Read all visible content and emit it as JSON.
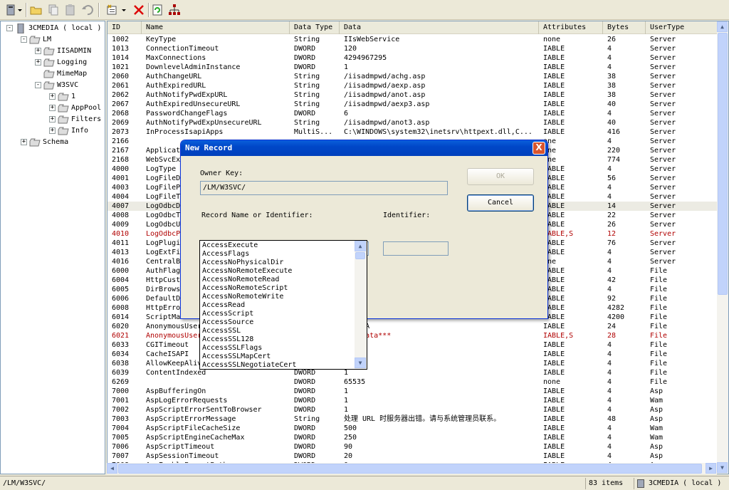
{
  "toolbar": {
    "icons": [
      "server-icon",
      "dropdown-arrow-icon",
      "open-folder-icon",
      "copy-icon",
      "paste-icon",
      "undo-icon",
      "new-record-icon",
      "dropdown-arrow-icon",
      "delete-icon",
      "refresh-icon",
      "network-icon"
    ]
  },
  "tree": {
    "nodes": [
      {
        "label": "3CMEDIA ( local )",
        "level": 0,
        "expander": "-"
      },
      {
        "label": "LM",
        "level": 1,
        "expander": "-"
      },
      {
        "label": "IISADMIN",
        "level": 2,
        "expander": "+"
      },
      {
        "label": "Logging",
        "level": 2,
        "expander": "+"
      },
      {
        "label": "MimeMap",
        "level": 2,
        "expander": ""
      },
      {
        "label": "W3SVC",
        "level": 2,
        "expander": "-"
      },
      {
        "label": "1",
        "level": 3,
        "expander": "+"
      },
      {
        "label": "AppPool",
        "level": 3,
        "expander": "+"
      },
      {
        "label": "Filters",
        "level": 3,
        "expander": "+"
      },
      {
        "label": "Info",
        "level": 3,
        "expander": "+"
      },
      {
        "label": "Schema",
        "level": 1,
        "expander": "+"
      }
    ]
  },
  "columns": [
    "ID",
    "Name",
    "Data Type",
    "Data",
    "Attributes",
    "Bytes",
    "UserType"
  ],
  "rows": [
    [
      "1002",
      "KeyType",
      "String",
      "IIsWebService",
      "none",
      "26",
      "Server"
    ],
    [
      "1013",
      "ConnectionTimeout",
      "DWORD",
      "120",
      "IABLE",
      "4",
      "Server"
    ],
    [
      "1014",
      "MaxConnections",
      "DWORD",
      "4294967295",
      "IABLE",
      "4",
      "Server"
    ],
    [
      "1021",
      "DownlevelAdminInstance",
      "DWORD",
      "1",
      "IABLE",
      "4",
      "Server"
    ],
    [
      "2060",
      "AuthChangeURL",
      "String",
      "/iisadmpwd/achg.asp",
      "IABLE",
      "38",
      "Server"
    ],
    [
      "2061",
      "AuthExpiredURL",
      "String",
      "/iisadmpwd/aexp.asp",
      "IABLE",
      "38",
      "Server"
    ],
    [
      "2062",
      "AuthNotifyPwdExpURL",
      "String",
      "/iisadmpwd/anot.asp",
      "IABLE",
      "38",
      "Server"
    ],
    [
      "2067",
      "AuthExpiredUnsecureURL",
      "String",
      "/iisadmpwd/aexp3.asp",
      "IABLE",
      "40",
      "Server"
    ],
    [
      "2068",
      "PasswordChangeFlags",
      "DWORD",
      "6",
      "IABLE",
      "4",
      "Server"
    ],
    [
      "2069",
      "AuthNotifyPwdExpUnsecureURL",
      "String",
      "/iisadmpwd/anot3.asp",
      "IABLE",
      "40",
      "Server"
    ],
    [
      "2073",
      "InProcessIsapiApps",
      "MultiS...",
      "C:\\WINDOWS\\system32\\inetsrv\\httpext.dll,C...",
      "IABLE",
      "416",
      "Server"
    ],
    [
      "2166",
      "",
      "",
      "",
      "one",
      "4",
      "Server"
    ],
    [
      "2167",
      "Applicat",
      "",
      "",
      "one",
      "220",
      "Server"
    ],
    [
      "2168",
      "WebSvcEx",
      "",
      "",
      "one",
      "774",
      "Server"
    ],
    [
      "4000",
      "LogType",
      "",
      "",
      "IABLE",
      "4",
      "Server"
    ],
    [
      "4001",
      "LogFileD",
      "",
      "",
      "IABLE",
      "56",
      "Server"
    ],
    [
      "4003",
      "LogFileP",
      "",
      "",
      "IABLE",
      "4",
      "Server"
    ],
    [
      "4004",
      "LogFileT",
      "",
      "",
      "IABLE",
      "4",
      "Server"
    ],
    [
      "4007",
      "LogOdbcD",
      "",
      "",
      "IABLE",
      "14",
      "Server"
    ],
    [
      "4008",
      "LogOdbcT",
      "",
      "",
      "IABLE",
      "22",
      "Server"
    ],
    [
      "4009",
      "LogOdbcU",
      "",
      "",
      "IABLE",
      "26",
      "Server"
    ],
    [
      "4010",
      "LogOdbcP",
      "",
      "",
      "IABLE,S",
      "12",
      "Server"
    ],
    [
      "4011",
      "LogPlugi",
      "",
      "",
      "IABLE",
      "76",
      "Server"
    ],
    [
      "4013",
      "LogExtFi",
      "",
      "",
      "IABLE",
      "4",
      "Server"
    ],
    [
      "4016",
      "CentralB",
      "",
      "",
      "one",
      "4",
      "Server"
    ],
    [
      "6000",
      "AuthFlag",
      "",
      "",
      "IABLE",
      "4",
      "File"
    ],
    [
      "6004",
      "HttpCust",
      "",
      "",
      "IABLE",
      "42",
      "File"
    ],
    [
      "6005",
      "DirBrows",
      "",
      "",
      "IABLE",
      "4",
      "File"
    ],
    [
      "6006",
      "DefaultD",
      "",
      "",
      "IABLE",
      "92",
      "File"
    ],
    [
      "6008",
      "HttpErro",
      "",
      "",
      "IABLE",
      "4282",
      "File"
    ],
    [
      "6014",
      "ScriptMa",
      "",
      "",
      "IABLE",
      "4200",
      "File"
    ],
    [
      "6020",
      "AnonymousUser",
      "",
      "CMEDIA",
      "IABLE",
      "24",
      "File"
    ],
    [
      "6021",
      "AnonymousUser",
      "",
      "ure Data***",
      "IABLE,S",
      "28",
      "File"
    ],
    [
      "6033",
      "CGITimeout",
      "",
      "",
      "IABLE",
      "4",
      "File"
    ],
    [
      "6034",
      "CacheISAPI",
      "",
      "",
      "IABLE",
      "4",
      "File"
    ],
    [
      "6038",
      "AllowKeepAliv",
      "",
      "",
      "IABLE",
      "4",
      "File"
    ],
    [
      "6039",
      "ContentIndexed",
      "DWORD",
      "1",
      "IABLE",
      "4",
      "File"
    ],
    [
      "6269",
      "",
      "DWORD",
      "65535",
      "none",
      "4",
      "File"
    ],
    [
      "7000",
      "AspBufferingOn",
      "DWORD",
      "1",
      "IABLE",
      "4",
      "Asp"
    ],
    [
      "7001",
      "AspLogErrorRequests",
      "DWORD",
      "1",
      "IABLE",
      "4",
      "Wam"
    ],
    [
      "7002",
      "AspScriptErrorSentToBrowser",
      "DWORD",
      "1",
      "IABLE",
      "4",
      "Asp"
    ],
    [
      "7003",
      "AspScriptErrorMessage",
      "String",
      "处理 URL 时服务器出错。请与系统管理员联系。",
      "IABLE",
      "48",
      "Asp"
    ],
    [
      "7004",
      "AspScriptFileCacheSize",
      "DWORD",
      "500",
      "IABLE",
      "4",
      "Wam"
    ],
    [
      "7005",
      "AspScriptEngineCacheMax",
      "DWORD",
      "250",
      "IABLE",
      "4",
      "Wam"
    ],
    [
      "7006",
      "AspScriptTimeout",
      "DWORD",
      "90",
      "IABLE",
      "4",
      "Asp"
    ],
    [
      "7007",
      "AspSessionTimeout",
      "DWORD",
      "20",
      "IABLE",
      "4",
      "Asp"
    ],
    [
      "7008",
      "AspEnableParentPaths",
      "DWORD",
      "0",
      "IABLE",
      "4",
      "Asp"
    ]
  ],
  "selected_row": 18,
  "red_rows": [
    21,
    32
  ],
  "status": {
    "path": "/LM/W3SVC/",
    "count": "83 items",
    "server": "3CMEDIA ( local )"
  },
  "dialog": {
    "title": "New Record",
    "close_label": "X",
    "owner_key_label": "Owner Key:",
    "owner_key_value": "/LM/W3SVC/",
    "record_name_label": "Record Name or Identifier:",
    "identifier_label": "Identifier:",
    "record_name_value": "",
    "identifier_value": "",
    "ok_label": "OK",
    "cancel_label": "Cancel",
    "options": [
      "AccessExecute",
      "AccessFlags",
      "AccessNoPhysicalDir",
      "AccessNoRemoteExecute",
      "AccessNoRemoteRead",
      "AccessNoRemoteScript",
      "AccessNoRemoteWrite",
      "AccessRead",
      "AccessScript",
      "AccessSource",
      "AccessSSL",
      "AccessSSL128",
      "AccessSSLFlags",
      "AccessSSLMapCert",
      "AccessSSLNegotiateCert"
    ]
  },
  "colors": {
    "title_bar": "#0047c8",
    "selection": "#ecebe3",
    "error_text": "#b00000"
  }
}
